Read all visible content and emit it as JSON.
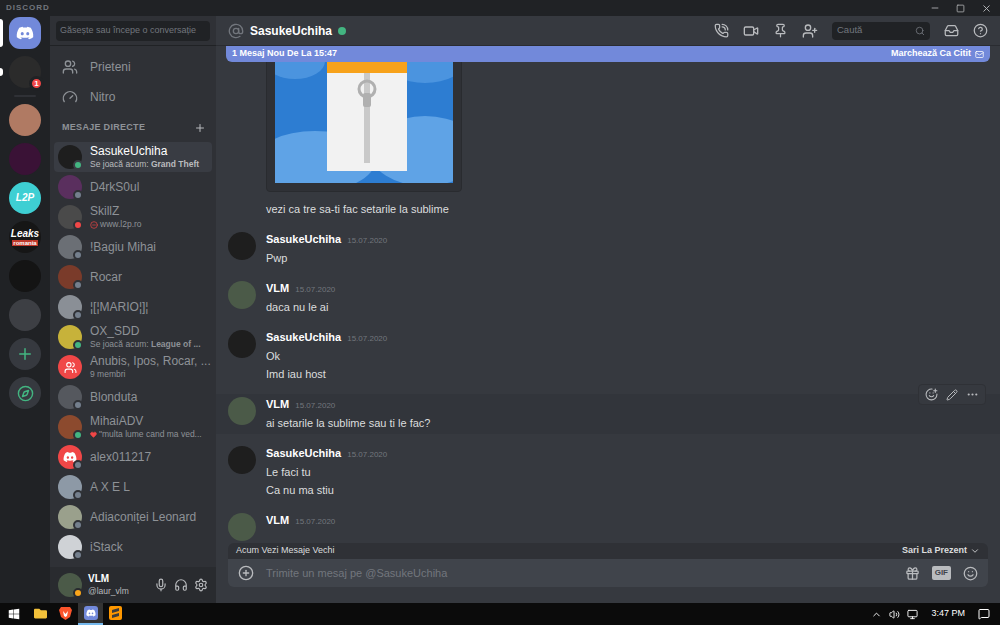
{
  "window": {
    "title": "DISCORD"
  },
  "servers": [
    {
      "kind": "home",
      "selected": true,
      "unread": false
    },
    {
      "kind": "avatar",
      "color": "#2b2b2b",
      "badge": "1",
      "selected": false,
      "unread": true
    },
    {
      "kind": "avatar",
      "color": "#b07a63",
      "selected": false,
      "unread": false
    },
    {
      "kind": "avatar",
      "color": "#3a1236",
      "selected": false,
      "unread": false
    },
    {
      "kind": "label",
      "color": "#3ecfd3",
      "label": "L2P",
      "selected": false,
      "unread": false
    },
    {
      "kind": "label",
      "color": "#161616",
      "label": "Leaks",
      "sublabel": "romania",
      "selected": false,
      "unread": false
    },
    {
      "kind": "avatar",
      "color": "#141414",
      "selected": false,
      "unread": false
    },
    {
      "kind": "avatar",
      "color": "#3d3f44",
      "selected": false,
      "unread": false
    },
    {
      "kind": "add",
      "selected": false,
      "unread": false
    },
    {
      "kind": "explore",
      "selected": false,
      "unread": false
    }
  ],
  "search": {
    "placeholder": "Găsește sau începe o conversație"
  },
  "nav": [
    {
      "label": "Prieteni",
      "kind": "friends"
    },
    {
      "label": "Nitro",
      "kind": "nitro"
    }
  ],
  "dm_header": "MESAJE DIRECTE",
  "dms": [
    {
      "name": "SasukeUchiha",
      "kind": "user",
      "status": "online",
      "color": "#43b581",
      "avatar_color": "#1e1e1e",
      "subtitle": "Se joacă acum: ",
      "subtitle_bold": "Grand Theft",
      "emoji_kind": null,
      "selected": true
    },
    {
      "name": "D4rkS0ul",
      "kind": "user",
      "status": "offline",
      "color": "#747f8d",
      "avatar_color": "#5a2f5e",
      "subtitle": null,
      "subtitle_bold": null,
      "emoji_kind": null,
      "selected": false
    },
    {
      "name": "SkillZ",
      "kind": "user",
      "status": "dnd",
      "color": "#f04747",
      "avatar_color": "#4a4a4a",
      "subtitle": "www.l2p.ro",
      "subtitle_bold": null,
      "emoji_kind": "no-entry",
      "selected": false
    },
    {
      "name": "!Bagiu Mihai",
      "kind": "user",
      "status": "offline",
      "color": "#747f8d",
      "avatar_color": "#6b6f75",
      "subtitle": null,
      "subtitle_bold": null,
      "emoji_kind": null,
      "selected": false
    },
    {
      "name": "Rocar",
      "kind": "user",
      "status": "offline",
      "color": "#747f8d",
      "avatar_color": "#7a3b2a",
      "subtitle": null,
      "subtitle_bold": null,
      "emoji_kind": null,
      "selected": false
    },
    {
      "name": "¦[¦MARIO¦]¦",
      "kind": "user",
      "status": "offline",
      "color": "#747f8d",
      "avatar_color": "#8a8f96",
      "subtitle": null,
      "subtitle_bold": null,
      "emoji_kind": null,
      "selected": false
    },
    {
      "name": "OX_SDD",
      "kind": "user",
      "status": "online",
      "color": "#43b581",
      "avatar_color": "#c7b23a",
      "subtitle": "Se joacă acum: ",
      "subtitle_bold": "League of ...",
      "emoji_kind": null,
      "selected": false
    },
    {
      "name": "Anubis, Ipos, Rocar, ...",
      "kind": "group",
      "status": null,
      "color": null,
      "avatar_color": "#f04747",
      "subtitle": "9 membri",
      "subtitle_bold": null,
      "emoji_kind": null,
      "selected": false
    },
    {
      "name": "Blonduta",
      "kind": "user",
      "status": "offline",
      "color": "#747f8d",
      "avatar_color": "#55585e",
      "subtitle": null,
      "subtitle_bold": null,
      "emoji_kind": null,
      "selected": false
    },
    {
      "name": "MihaiADV",
      "kind": "user",
      "status": "online",
      "color": "#43b581",
      "avatar_color": "#8c4a2e",
      "subtitle": "\"multa lume cand ma ved...",
      "subtitle_bold": null,
      "emoji_kind": "heart",
      "selected": false
    },
    {
      "name": "alex011217",
      "kind": "default",
      "status": "offline",
      "color": "#747f8d",
      "avatar_color": "#f04747",
      "subtitle": null,
      "subtitle_bold": null,
      "emoji_kind": null,
      "selected": false
    },
    {
      "name": "A X E L",
      "kind": "user",
      "status": "offline",
      "color": "#747f8d",
      "avatar_color": "#8d99a6",
      "subtitle": null,
      "subtitle_bold": null,
      "emoji_kind": null,
      "selected": false
    },
    {
      "name": "Adiaconiței Leonard",
      "kind": "user",
      "status": "offline",
      "color": "#747f8d",
      "avatar_color": "#9aa08c",
      "subtitle": null,
      "subtitle_bold": null,
      "emoji_kind": null,
      "selected": false
    },
    {
      "name": "iStack",
      "kind": "user",
      "status": "offline",
      "color": "#747f8d",
      "avatar_color": "#cfd2d6",
      "subtitle": null,
      "subtitle_bold": null,
      "emoji_kind": null,
      "selected": false
    }
  ],
  "user_panel": {
    "name": "VLM",
    "tag": "@laur_vlm",
    "color": "#faa61a",
    "avatar_color": "#4b5a48"
  },
  "chat": {
    "name": "SasukeUchiha",
    "status_color": "#43b581",
    "search": "Caută",
    "new_bar": {
      "text": "1 Mesaj Nou De La 15:47",
      "action": "Marchează Ca Citit"
    },
    "messages": [
      {
        "author": null,
        "time": null,
        "avatar_color": null,
        "attachment": true,
        "hovered": false,
        "lines": [
          "vezi ca tre sa-ti fac setarile la sublime"
        ]
      },
      {
        "author": "SasukeUchiha",
        "time": "15.07.2020",
        "avatar_color": "#1e1e1e",
        "attachment": false,
        "hovered": false,
        "lines": [
          "Pwp"
        ]
      },
      {
        "author": "VLM",
        "time": "15.07.2020",
        "avatar_color": "#4b5a48",
        "attachment": false,
        "hovered": false,
        "lines": [
          "daca nu le ai"
        ]
      },
      {
        "author": "SasukeUchiha",
        "time": "15.07.2020",
        "avatar_color": "#1e1e1e",
        "attachment": false,
        "hovered": false,
        "lines": [
          "Ok",
          "Imd iau host"
        ]
      },
      {
        "author": "VLM",
        "time": "15.07.2020",
        "avatar_color": "#4b5a48",
        "attachment": false,
        "hovered": true,
        "lines": [
          "ai setarile la sublime sau ti le fac?"
        ]
      },
      {
        "author": "SasukeUchiha",
        "time": "15.07.2020",
        "avatar_color": "#1e1e1e",
        "attachment": false,
        "hovered": false,
        "lines": [
          "Le faci tu",
          "Ca nu ma stiu"
        ]
      },
      {
        "author": "VLM",
        "time": "15.07.2020",
        "avatar_color": "#4b5a48",
        "attachment": false,
        "hovered": false,
        "lines": []
      }
    ],
    "jump_bar": {
      "text": "Acum Vezi Mesaje Vechi",
      "action": "Sari La Prezent"
    },
    "composer": {
      "placeholder": "Trimite un mesaj pe @SasukeUchiha",
      "gif": "GIF"
    }
  },
  "taskbar": {
    "apps": [
      {
        "kind": "explorer",
        "active": false
      },
      {
        "kind": "brave",
        "active": false
      },
      {
        "kind": "discord",
        "active": true
      },
      {
        "kind": "sublime",
        "active": false
      }
    ],
    "time": "3:47 PM"
  }
}
